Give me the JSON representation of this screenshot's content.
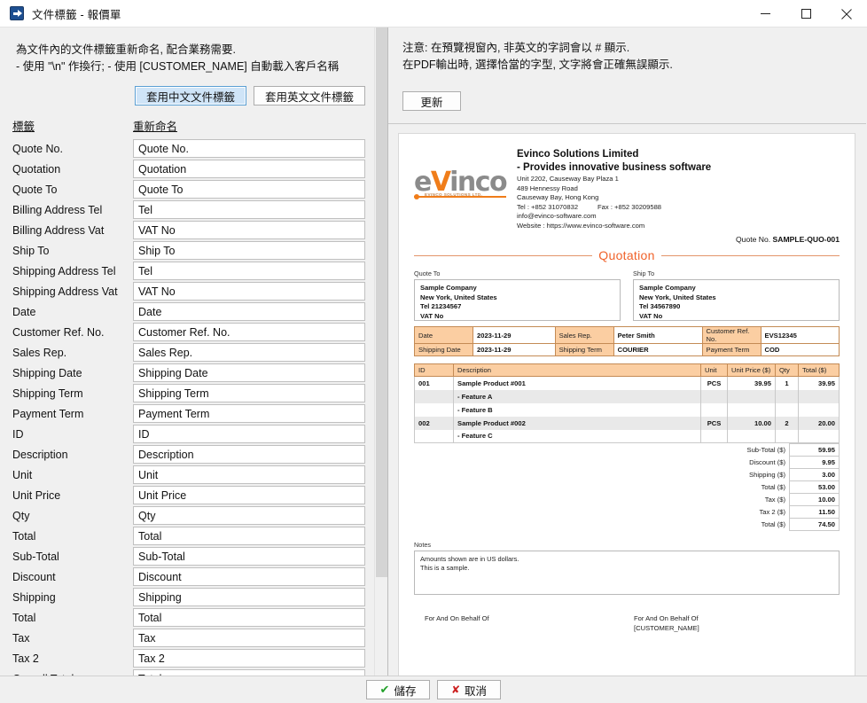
{
  "window": {
    "title": "文件標籤 - 報價單",
    "app_icon": "export-arrow-icon",
    "minimize": "—",
    "maximize": "□",
    "close": "✕"
  },
  "left": {
    "instruction_line1": "為文件內的文件標籤重新命名, 配合業務需要.",
    "instruction_line2": "- 使用 \"\\n\" 作換行; - 使用 [CUSTOMER_NAME] 自動載入客戶名稱",
    "apply_chinese_label": "套用中文文件標籤",
    "apply_english_label": "套用英文文件標籤",
    "col_label_header": "標籤",
    "col_rename_header": "重新命名",
    "rows": [
      {
        "label": "Quote No.",
        "value": "Quote No."
      },
      {
        "label": "Quotation",
        "value": "Quotation"
      },
      {
        "label": "Quote To",
        "value": "Quote To"
      },
      {
        "label": "Billing Address Tel",
        "value": "Tel"
      },
      {
        "label": "Billing Address Vat",
        "value": "VAT No"
      },
      {
        "label": "Ship To",
        "value": "Ship To"
      },
      {
        "label": "Shipping Address Tel",
        "value": "Tel"
      },
      {
        "label": "Shipping Address Vat",
        "value": "VAT No"
      },
      {
        "label": "Date",
        "value": "Date"
      },
      {
        "label": "Customer Ref. No.",
        "value": "Customer Ref. No."
      },
      {
        "label": "Sales Rep.",
        "value": "Sales Rep."
      },
      {
        "label": "Shipping Date",
        "value": "Shipping Date"
      },
      {
        "label": "Shipping Term",
        "value": "Shipping Term"
      },
      {
        "label": "Payment Term",
        "value": "Payment Term"
      },
      {
        "label": "ID",
        "value": "ID"
      },
      {
        "label": "Description",
        "value": "Description"
      },
      {
        "label": "Unit",
        "value": "Unit"
      },
      {
        "label": "Unit Price",
        "value": "Unit Price"
      },
      {
        "label": "Qty",
        "value": "Qty"
      },
      {
        "label": "Total",
        "value": "Total"
      },
      {
        "label": "Sub-Total",
        "value": "Sub-Total"
      },
      {
        "label": "Discount",
        "value": "Discount"
      },
      {
        "label": "Shipping",
        "value": "Shipping"
      },
      {
        "label": "Total",
        "value": "Total"
      },
      {
        "label": "Tax",
        "value": "Tax"
      },
      {
        "label": "Tax 2",
        "value": "Tax 2"
      },
      {
        "label": "Overall Total",
        "value": "Total"
      }
    ]
  },
  "right": {
    "note_line1": "注意: 在預覽視窗內, 非英文的字詞會以 # 顯示.",
    "note_line2": "在PDF輸出時, 選擇恰當的字型, 文字將會正確無誤顯示.",
    "refresh_label": "更新"
  },
  "preview": {
    "logo_text_a": "e",
    "logo_text_v": "V",
    "logo_text_b": "inco",
    "logo_subtitle": "EVINCO SOLUTIONS LTD.",
    "company_name": "Evinco Solutions Limited",
    "company_tagline": "- Provides innovative business software",
    "address1": "Unit 2202, Causeway Bay Plaza 1",
    "address2": "489 Hennessy Road",
    "address3": "Causeway Bay, Hong Kong",
    "tel": "Tel : +852 31070832",
    "fax": "Fax : +852 30209588",
    "email": "info@evinco-software.com",
    "website": "Website : https://www.evinco-software.com",
    "quote_no_label": "Quote No.",
    "quote_no_value": "SAMPLE-QUO-001",
    "doc_title": "Quotation",
    "quote_to_caption": "Quote To",
    "ship_to_caption": "Ship To",
    "quote_to": {
      "name": "Sample Company",
      "city": "New York, United States",
      "tel": "Tel 21234567",
      "vat": "VAT No"
    },
    "ship_to": {
      "name": "Sample Company",
      "city": "New York, United States",
      "tel": "Tel 34567890",
      "vat": "VAT No"
    },
    "info": {
      "date_label": "Date",
      "date_value": "2023-11-29",
      "sales_rep_label": "Sales Rep.",
      "sales_rep_value": "Peter Smith",
      "cust_ref_label": "Customer Ref. No.",
      "cust_ref_value": "EVS12345",
      "ship_date_label": "Shipping Date",
      "ship_date_value": "2023-11-29",
      "ship_term_label": "Shipping Term",
      "ship_term_value": "COURIER",
      "pay_term_label": "Payment Term",
      "pay_term_value": "COD"
    },
    "items_headers": {
      "id": "ID",
      "description": "Description",
      "unit": "Unit",
      "unit_price": "Unit Price ($)",
      "qty": "Qty",
      "total": "Total ($)"
    },
    "items": [
      {
        "id": "001",
        "description": "Sample Product #001",
        "unit": "PCS",
        "unit_price": "39.95",
        "qty": "1",
        "total": "39.95",
        "alt": false
      },
      {
        "id": "",
        "description": "- Feature A",
        "unit": "",
        "unit_price": "",
        "qty": "",
        "total": "",
        "alt": true
      },
      {
        "id": "",
        "description": "- Feature B",
        "unit": "",
        "unit_price": "",
        "qty": "",
        "total": "",
        "alt": false
      },
      {
        "id": "002",
        "description": "Sample Product #002",
        "unit": "PCS",
        "unit_price": "10.00",
        "qty": "2",
        "total": "20.00",
        "alt": true
      },
      {
        "id": "",
        "description": "- Feature C",
        "unit": "",
        "unit_price": "",
        "qty": "",
        "total": "",
        "alt": false
      }
    ],
    "totals": [
      {
        "label": "Sub-Total ($)",
        "value": "59.95"
      },
      {
        "label": "Discount ($)",
        "value": "9.95"
      },
      {
        "label": "Shipping ($)",
        "value": "3.00"
      },
      {
        "label": "Total ($)",
        "value": "53.00"
      },
      {
        "label": "Tax ($)",
        "value": "10.00"
      },
      {
        "label": "Tax 2 ($)",
        "value": "11.50"
      },
      {
        "label": "Total ($)",
        "value": "74.50"
      }
    ],
    "notes_caption": "Notes",
    "notes_line1": "Amounts shown are in US dollars.",
    "notes_line2": "This is a sample.",
    "sign_left": "For And On Behalf Of",
    "sign_right_1": "For And On Behalf Of",
    "sign_right_2": "[CUSTOMER_NAME]"
  },
  "footer": {
    "save_label": "儲存",
    "cancel_label": "取消",
    "save_icon": "check-icon",
    "cancel_icon": "cross-icon"
  },
  "colors": {
    "accent_orange": "#f0622a",
    "table_header": "#fbceA2",
    "focus_blue": "#cfe4f7"
  }
}
